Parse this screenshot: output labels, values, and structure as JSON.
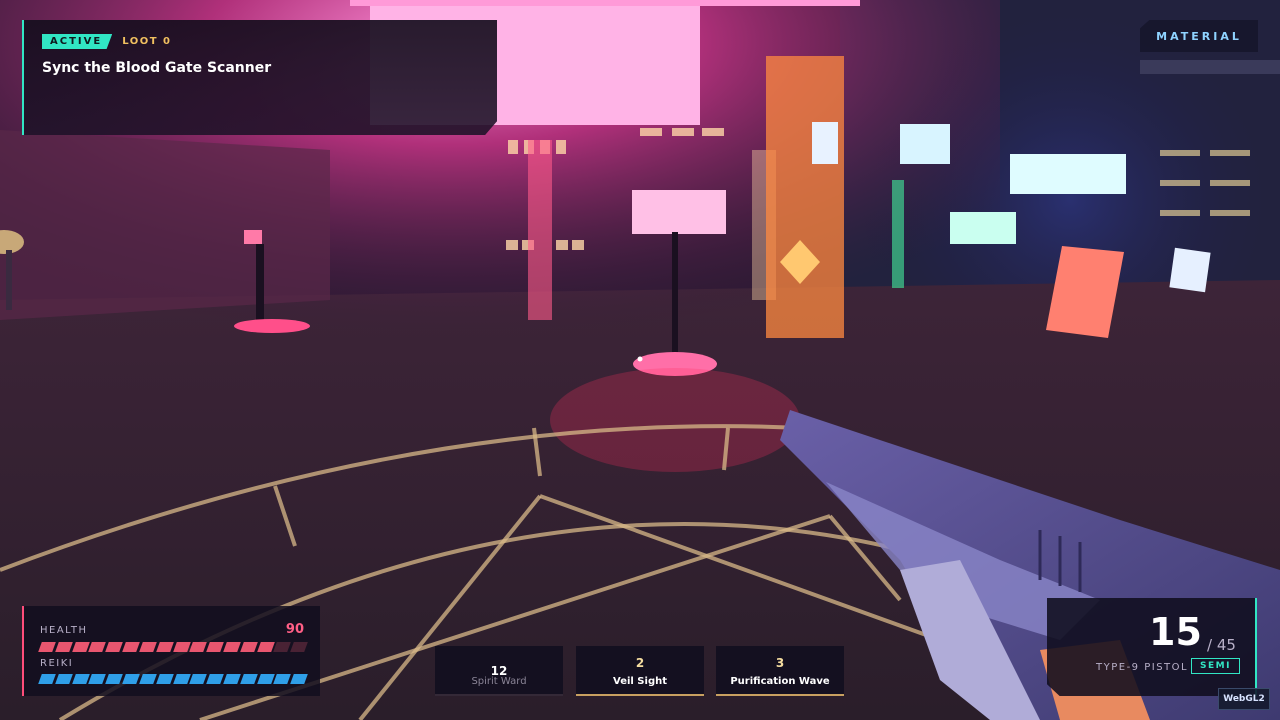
{
  "objective": {
    "status": "ACTIVE",
    "loot": "LOOT 0",
    "title": "Sync the Blood Gate Scanner"
  },
  "material_tag": "MATERIAL",
  "vitals": {
    "health_label": "HEALTH",
    "health_value": "90",
    "health_fraction": 0.9,
    "reiki_label": "REIKI",
    "reiki_fraction": 1.0
  },
  "abilities": [
    {
      "key": "12",
      "name": "Spirit Ward",
      "state": "cooldown"
    },
    {
      "key": "2",
      "name": "Veil Sight",
      "state": "ready"
    },
    {
      "key": "3",
      "name": "Purification Wave",
      "state": "ready"
    }
  ],
  "weapon": {
    "ammo_current": "15",
    "ammo_reserve": "/ 45",
    "name": "TYPE-9 PISTOL",
    "fire_mode": "SEMI"
  },
  "renderer_badge": "WebGL2",
  "colors": {
    "accent_teal": "#31e6c4",
    "health": "#e8566f",
    "reiki": "#2f9fe8",
    "loot_gold": "#f0c060"
  },
  "icons": [
    "crosshair-icon"
  ]
}
